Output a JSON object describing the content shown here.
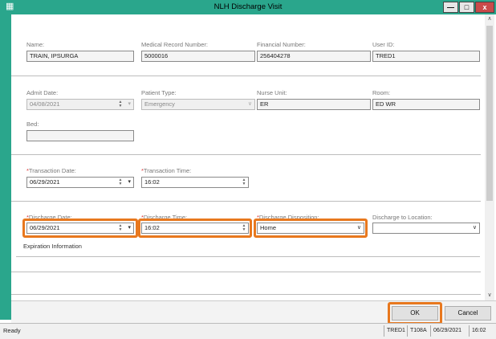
{
  "window": {
    "title": "NLH Discharge Visit"
  },
  "patient": {
    "name_label": "Name:",
    "name_value": "TRAIN, IPSURGA",
    "mrn_label": "Medical Record Number:",
    "mrn_value": "5000016",
    "fin_label": "Financial Number:",
    "fin_value": "256404278",
    "user_label": "User ID:",
    "user_value": "TRED1"
  },
  "visit": {
    "admit_label": "Admit Date:",
    "admit_value": "04/08/2021",
    "ptype_label": "Patient Type:",
    "ptype_value": "Emergency",
    "unit_label": "Nurse Unit:",
    "unit_value": "ER",
    "room_label": "Room:",
    "room_value": "ED WR",
    "bed_label": "Bed:",
    "bed_value": ""
  },
  "transaction": {
    "date_req": "*",
    "date_label": "Transaction Date:",
    "date_value": "06/29/2021",
    "time_req": "*",
    "time_label": "Transaction Time:",
    "time_value": "16:02"
  },
  "discharge": {
    "date_req": "*",
    "date_label": "Discharge Date:",
    "date_value": "06/29/2021",
    "time_req": "*",
    "time_label": "Discharge Time:",
    "time_value": "16:02",
    "disp_req": "*",
    "disp_label": "Discharge Disposition:",
    "disp_value": "Home",
    "loc_label": "Discharge to Location:",
    "loc_value": ""
  },
  "expiration": {
    "label": "Expiration Information"
  },
  "buttons": {
    "ok": "OK",
    "cancel": "Cancel"
  },
  "status": {
    "text": "Ready",
    "user": "TRED1",
    "terminal": "T108A",
    "date": "06/29/2021",
    "time": "16:02"
  },
  "colors": {
    "titlebar": "#2aa68c",
    "highlight": "#e8781e",
    "required": "#d33333"
  }
}
